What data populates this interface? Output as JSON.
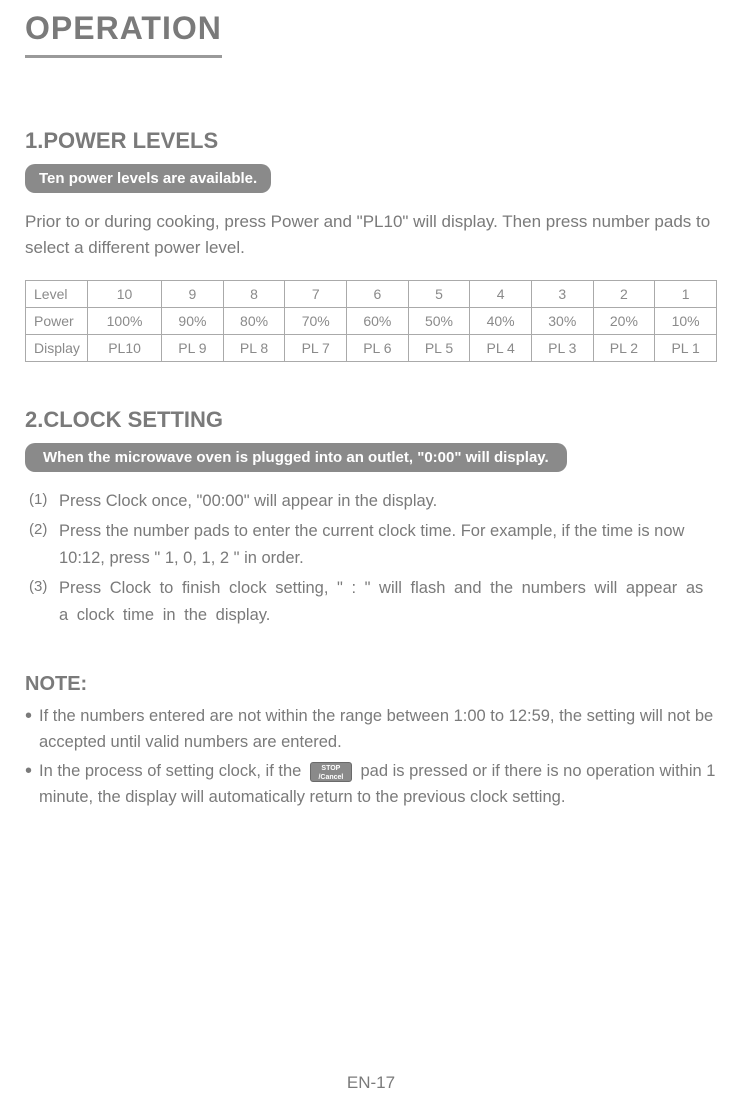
{
  "main_title": "OPERATION",
  "section1": {
    "title": "1.POWER LEVELS",
    "pill": "Ten power levels are available.",
    "intro": "Prior to or during cooking, press Power and \"PL10\" will display. Then press number pads to select a different power level.",
    "table": {
      "row_headers": [
        "Level",
        "Power",
        "Display"
      ],
      "level": [
        "10",
        "9",
        "8",
        "7",
        "6",
        "5",
        "4",
        "3",
        "2",
        "1"
      ],
      "power": [
        "100%",
        "90%",
        "80%",
        "70%",
        "60%",
        "50%",
        "40%",
        "30%",
        "20%",
        "10%"
      ],
      "display": [
        "PL10",
        "PL 9",
        "PL 8",
        "PL 7",
        "PL 6",
        "PL 5",
        "PL 4",
        "PL 3",
        "PL 2",
        "PL 1"
      ]
    }
  },
  "section2": {
    "title": "2.CLOCK SETTING",
    "pill": "When the microwave oven is plugged into an outlet, \"0:00\" will display.",
    "steps": [
      {
        "n": "(1)",
        "t": "Press Clock once, \"00:00\" will appear in the display."
      },
      {
        "n": "(2)",
        "t": "Press the number pads to enter the current clock time. For example, if the time is now 10:12, press \" 1, 0, 1, 2 \" in order."
      },
      {
        "n": "(3)",
        "t": "Press Clock to finish clock setting, \" : \" will flash and the numbers will appear as a clock  time in the display."
      }
    ]
  },
  "note": {
    "title": "NOTE:",
    "items": [
      "If the numbers entered are not within the range between 1:00 to 12:59, the setting will not be accepted until valid numbers are entered.",
      "In the process of setting clock, if the __STOP__ pad is pressed or if there is no operation within 1 minute,  the display will automatically return to the previous clock setting."
    ],
    "stop_button_label": "STOP\n/Cancel"
  },
  "page_number": "EN-17"
}
